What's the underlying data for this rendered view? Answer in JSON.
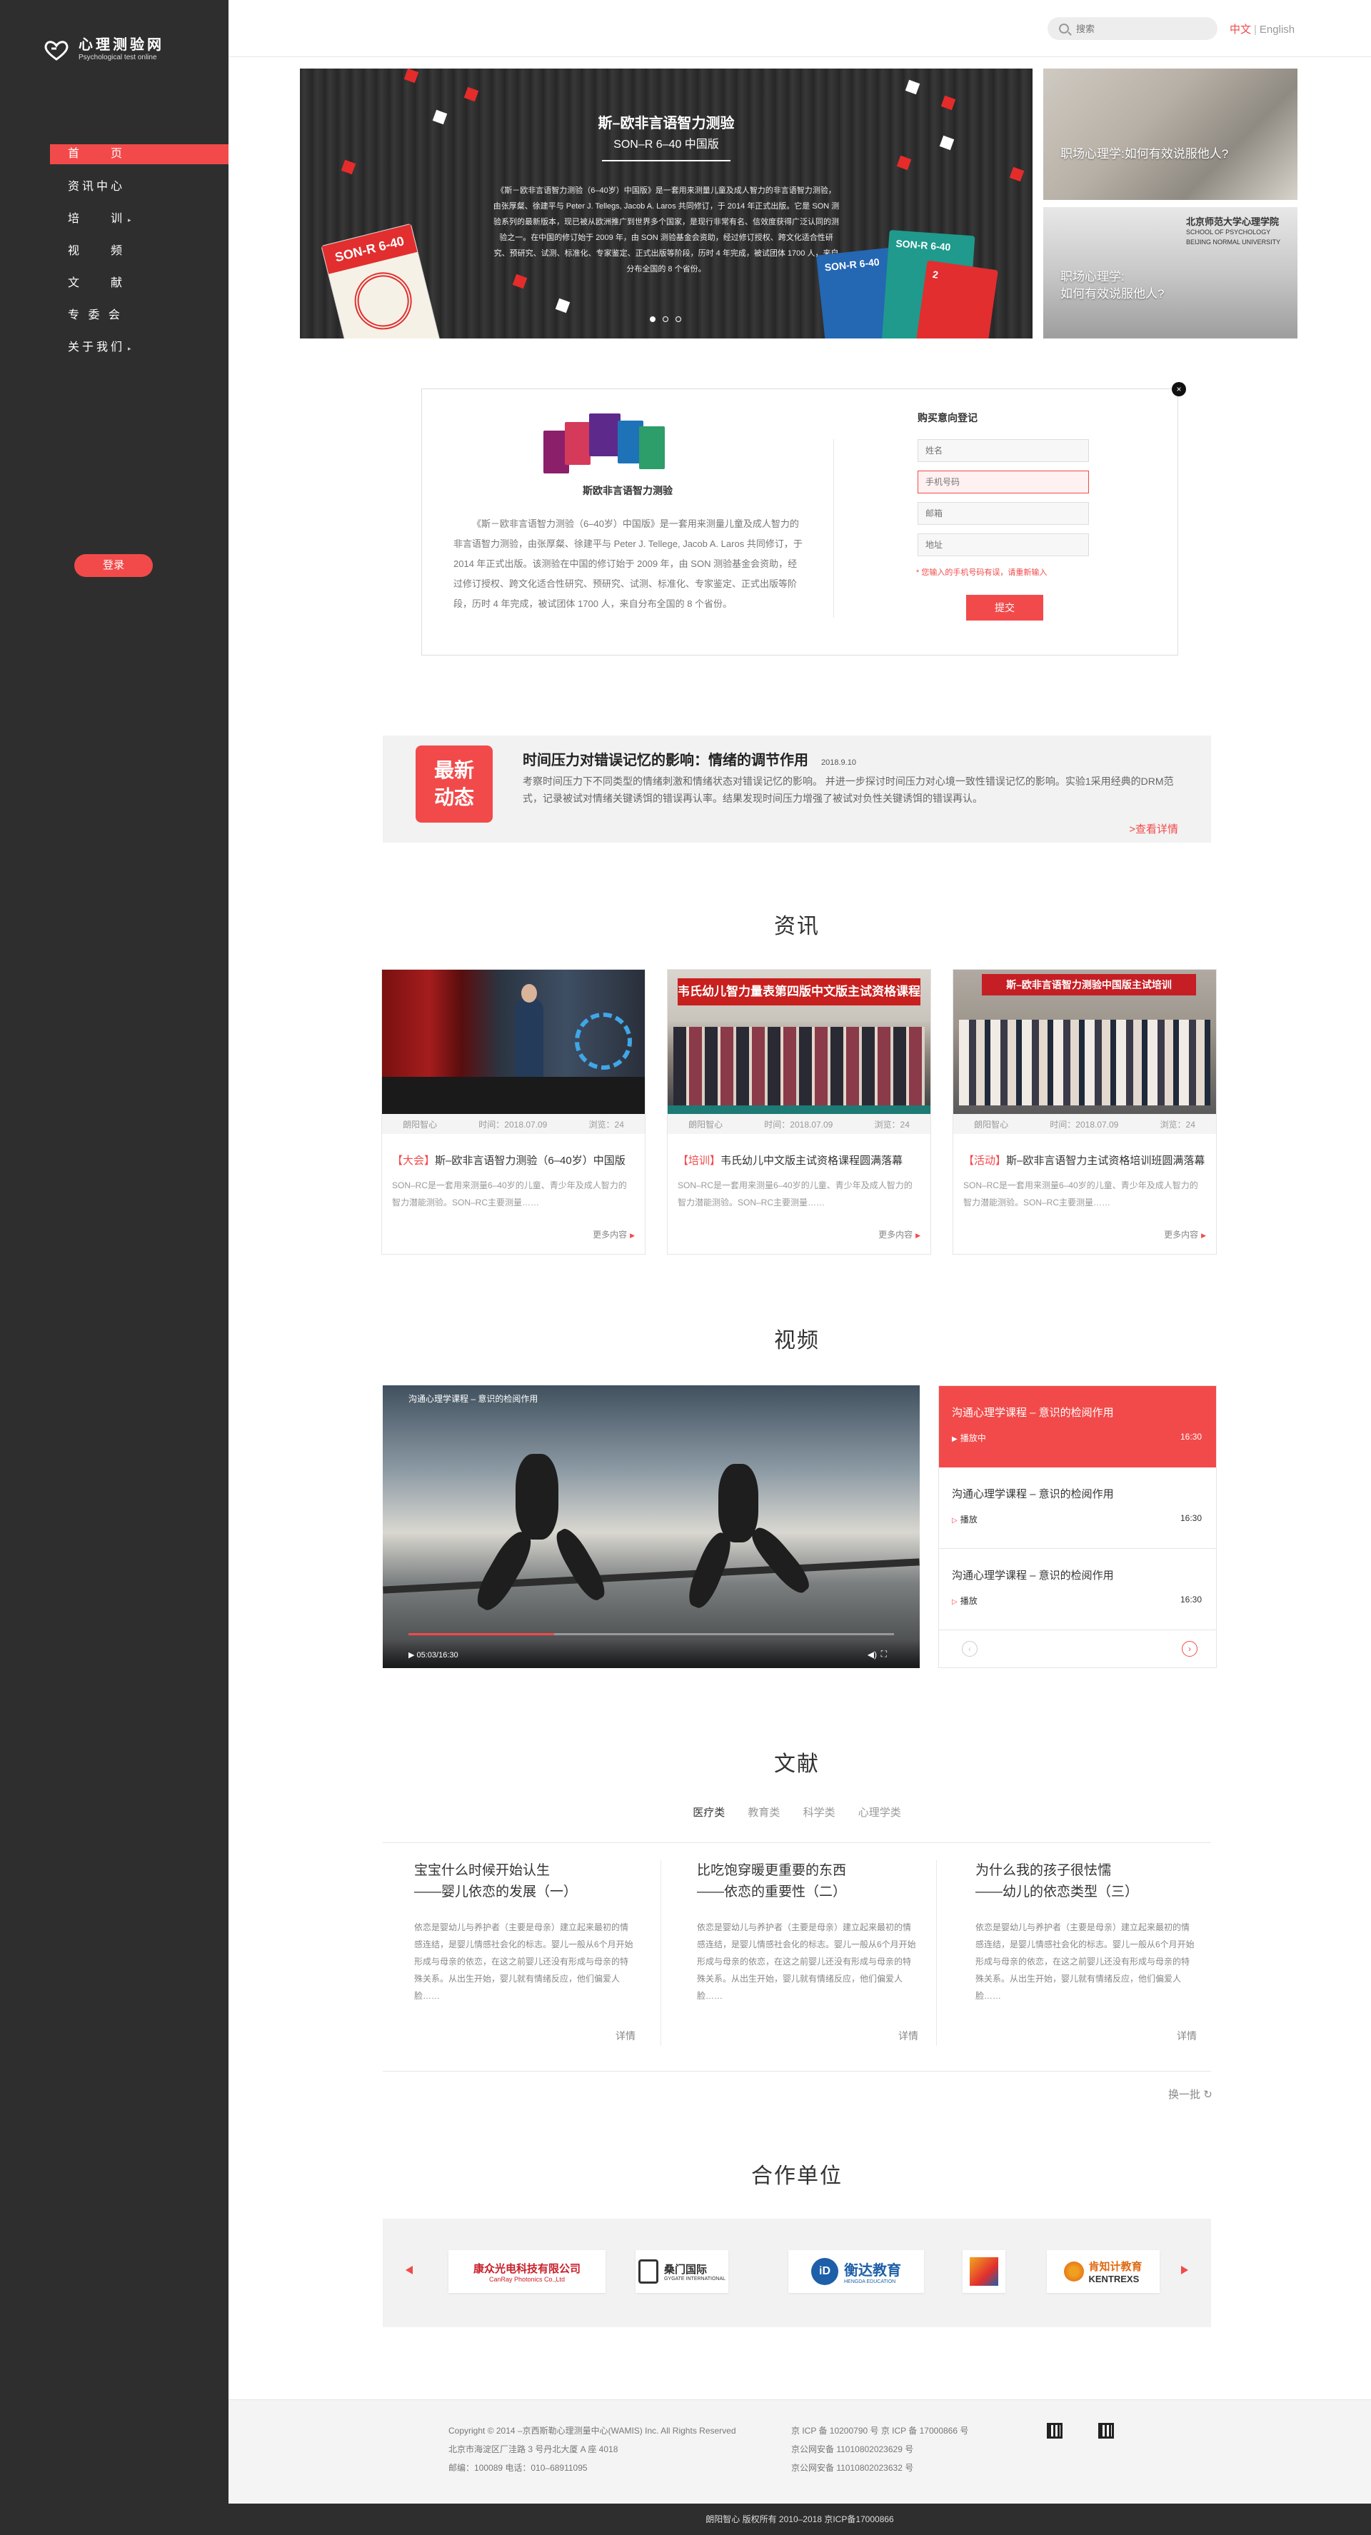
{
  "brand": {
    "name_cn": "心理测验网",
    "name_en": "Psychological test online"
  },
  "sidebar": {
    "items": [
      {
        "label": "首　　页",
        "active": true
      },
      {
        "label": "资讯中心"
      },
      {
        "label": "培　　训",
        "caret": "▸"
      },
      {
        "label": "视　　频"
      },
      {
        "label": "文　　献"
      },
      {
        "label": "专 委 会"
      },
      {
        "label": "关于我们",
        "caret": "▸"
      }
    ],
    "login_label": "登录"
  },
  "header": {
    "search_placeholder": "搜索",
    "lang_cn": "中文",
    "lang_sep": "|",
    "lang_en": "English"
  },
  "hero": {
    "title": "斯–欧非言语智力测验",
    "subtitle": "SON–R 6–40 中国版",
    "description": "《斯－欧非言语智力测验（6–40岁）中国版》是一套用来测量儿童及成人智力的非言语智力测验，由张厚粲、徐建平与 Peter J. Tellegs, Jacob A. Laros 共同修订，于 2014 年正式出版。它是 SON 测验系列的最新版本，现已被从欧洲推广到世界多个国家，是现行非常有名、信效度获得广泛认同的测验之一。在中国的修订始于 2009 年，由 SON 测验基金会资助，经过修订授权、跨文化适合性研究、预研究、试测、标准化、专家鉴定、正式出版等阶段，历时 4 年完成，被试团体 1700 人，来自分布全国的 8 个省份。",
    "book_labels": [
      "SON-R 6-40",
      "SON-R 6-40",
      "SON-R 6-40",
      "2"
    ],
    "slide_count": 3,
    "active_slide": 1,
    "side_cards": [
      {
        "caption": "职场心理学:如何有效说服他人?"
      },
      {
        "caption_line1": "职场心理学:",
        "caption_line2": "如何有效说服他人?",
        "sign_line1": "北京师范大学心理学院",
        "sign_line2": "SCHOOL OF PSYCHOLOGY",
        "sign_line3": "BEIJING NORMAL UNIVERSITY"
      }
    ]
  },
  "purchase": {
    "close": "×",
    "product_title": "斯欧非言语智力测验",
    "product_desc": "《斯－欧非言语智力测验（6–40岁）中国版》是一套用来测量儿童及成人智力的非言语智力测验，由张厚粲、徐建平与 Peter J. Tellege, Jacob A. Laros 共同修订，于 2014 年正式出版。该测验在中国的修订始于 2009 年，由 SON 测验基金会资助，经过修订授权、跨文化适合性研究、预研究、试测、标准化、专家鉴定、正式出版等阶段，历时 4 年完成，被试团体 1700 人，来自分布全国的 8 个省份。",
    "form_title": "购买意向登记",
    "fields": {
      "name": "姓名",
      "phone": "手机号码",
      "email": "邮箱",
      "address": "地址"
    },
    "error": "* 您输入的手机号码有误，请重新输入",
    "submit": "提交"
  },
  "latest": {
    "badge_line1": "最新",
    "badge_line2": "动态",
    "title": "时间压力对错误记忆的影响：情绪的调节作用",
    "date": "2018.9.10",
    "body": "考察时间压力下不同类型的情绪刺激和情绪状态对错误记忆的影响。 并进一步探讨时间压力对心境一致性错误记忆的影响。实验1采用经典的DRM范式，记录被试对情绪关键诱饵的错误再认率。结果发现时间压力增强了被试对负性关键诱饵的错误再认。",
    "more": ">查看详情"
  },
  "news": {
    "title": "资讯",
    "cards": [
      {
        "source": "朗阳智心",
        "time": "时间：2018.07.09",
        "views": "浏览：24",
        "tag": "【大会】",
        "title": "斯–欧非言语智力测验（6–40岁）中国版",
        "desc": "SON–RC是一套用来测量6–40岁的儿童、青少年及成人智力的智力潜能测验。SON–RC主要测量……",
        "more": "更多内容",
        "photo_text": ""
      },
      {
        "source": "朗阳智心",
        "time": "时间：2018.07.09",
        "views": "浏览：24",
        "tag": "【培训】",
        "title": "韦氏幼儿中文版主试资格课程圆满落幕",
        "desc": "SON–RC是一套用来测量6–40岁的儿童、青少年及成人智力的智力潜能测验。SON–RC主要测量……",
        "more": "更多内容",
        "photo_text": "韦氏幼儿智力量表第四版中文版主试资格课程"
      },
      {
        "source": "朗阳智心",
        "time": "时间：2018.07.09",
        "views": "浏览：24",
        "tag": "【活动】",
        "title": "斯–欧非言语智力主试资格培训班圆满落幕",
        "desc": "SON–RC是一套用来测量6–40岁的儿童、青少年及成人智力的智力潜能测验。SON–RC主要测量……",
        "more": "更多内容",
        "photo_text": "斯–欧非言语智力测验中国版主试培训"
      }
    ]
  },
  "video": {
    "title": "视频",
    "now_playing": "沟通心理学课程 – 意识的检阅作用",
    "time": "05:03/16:30",
    "progress": 0.3,
    "playlist": [
      {
        "title": "沟通心理学课程 – 意识的检阅作用",
        "status": "播放中",
        "duration": "16:30",
        "active": true
      },
      {
        "title": "沟通心理学课程 – 意识的检阅作用",
        "status": "播放",
        "duration": "16:30"
      },
      {
        "title": "沟通心理学课程 – 意识的检阅作用",
        "status": "播放",
        "duration": "16:30"
      }
    ],
    "prev_icon": "‹",
    "next_icon": "›"
  },
  "literature": {
    "title": "文献",
    "tabs": [
      "医疗类",
      "教育类",
      "科学类",
      "心理学类"
    ],
    "active_tab": 0,
    "items": [
      {
        "title_line1": "宝宝什么时候开始认生",
        "title_line2": "——婴儿依恋的发展（一）",
        "desc": "依恋是婴幼儿与养护者（主要是母亲）建立起来最初的情感连结，是婴儿情感社会化的标志。婴儿一般从6个月开始形成与母亲的依恋，在这之前婴儿还没有形成与母亲的特殊关系。从出生开始，婴儿就有情绪反应，他们偏爱人脸……",
        "more": "详情"
      },
      {
        "title_line1": "比吃饱穿暖更重要的东西",
        "title_line2": "——依恋的重要性（二）",
        "desc": "依恋是婴幼儿与养护者（主要是母亲）建立起来最初的情感连结，是婴儿情感社会化的标志。婴儿一般从6个月开始形成与母亲的依恋，在这之前婴儿还没有形成与母亲的特殊关系。从出生开始，婴儿就有情绪反应，他们偏爱人脸……",
        "more": "详情"
      },
      {
        "title_line1": "为什么我的孩子很怯懦",
        "title_line2": "——幼儿的依恋类型（三）",
        "desc": "依恋是婴幼儿与养护者（主要是母亲）建立起来最初的情感连结，是婴儿情感社会化的标志。婴儿一般从6个月开始形成与母亲的依恋，在这之前婴儿还没有形成与母亲的特殊关系。从出生开始，婴儿就有情绪反应，他们偏爱人脸……",
        "more": "详情"
      }
    ],
    "swap": "换一批",
    "swap_icon": "↻"
  },
  "partners": {
    "title": "合作单位",
    "logos": [
      {
        "name": "康众光电科技有限公司",
        "sub": "CanRay Photonics Co.,Ltd"
      },
      {
        "name": "桑门国际",
        "sub": "GYGATE INTERNATIONAL"
      },
      {
        "name": "衡达教育",
        "sub": "HENGDA EDUCATION"
      },
      {
        "name": "",
        "sub": ""
      },
      {
        "name": "肯知计教育",
        "sub": "KENTREXS"
      }
    ]
  },
  "footer": {
    "col1": [
      "Copyright © 2014 –京西斯勒心理测量中心(WAMIS) Inc. All Rights Reserved",
      "北京市海淀区厂洼路 3 号丹北大厦 A 座 4018",
      "邮编：100089 电话：010–68911095"
    ],
    "col2": [
      "京 ICP 备 10200790 号 京 ICP 备 17000866 号",
      "京公网安备 11010802023629 号",
      "京公网安备 11010802023632 号"
    ],
    "copyright": "朗阳智心 版权所有 2010–2018 京ICP备17000866"
  },
  "colors": {
    "accent": "#f24a4a",
    "sidebar": "#2e2e2e"
  }
}
